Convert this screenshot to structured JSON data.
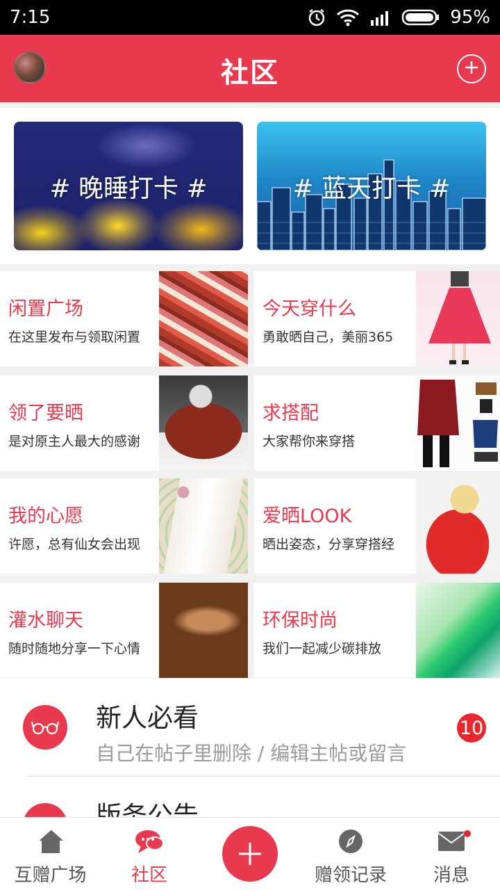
{
  "status_bar": {
    "time": "7:15",
    "battery": "95%"
  },
  "header": {
    "title": "社区"
  },
  "banners": [
    {
      "label": "# 晚睡打卡 #"
    },
    {
      "label": "# 蓝天打卡 #"
    }
  ],
  "grid": [
    {
      "title": "闲置广场",
      "subtitle": "在这里发布与领取闲置"
    },
    {
      "title": "今天穿什么",
      "subtitle": "勇敢晒自己，美丽365"
    },
    {
      "title": "领了要晒",
      "subtitle": "是对原主人最大的感谢"
    },
    {
      "title": "求搭配",
      "subtitle": "大家帮你来穿搭"
    },
    {
      "title": "我的心愿",
      "subtitle": "许愿，总有仙女会出现"
    },
    {
      "title": "爱晒LOOK",
      "subtitle": "晒出姿态，分享穿搭经"
    },
    {
      "title": "灌水聊天",
      "subtitle": "随时随地分享一下心情"
    },
    {
      "title": "环保时尚",
      "subtitle": "我们一起减少碳排放"
    }
  ],
  "list": [
    {
      "title": "新人必看",
      "subtitle": "自己在帖子里删除 / 编辑主帖或留言",
      "badge": "10"
    },
    {
      "title": "版务公告",
      "subtitle": "",
      "badge": ""
    }
  ],
  "nav": {
    "home": "互赠广场",
    "community": "社区",
    "records": "赠领记录",
    "messages": "消息"
  },
  "colors": {
    "accent": "#e8394e",
    "badge": "#e8262e"
  }
}
